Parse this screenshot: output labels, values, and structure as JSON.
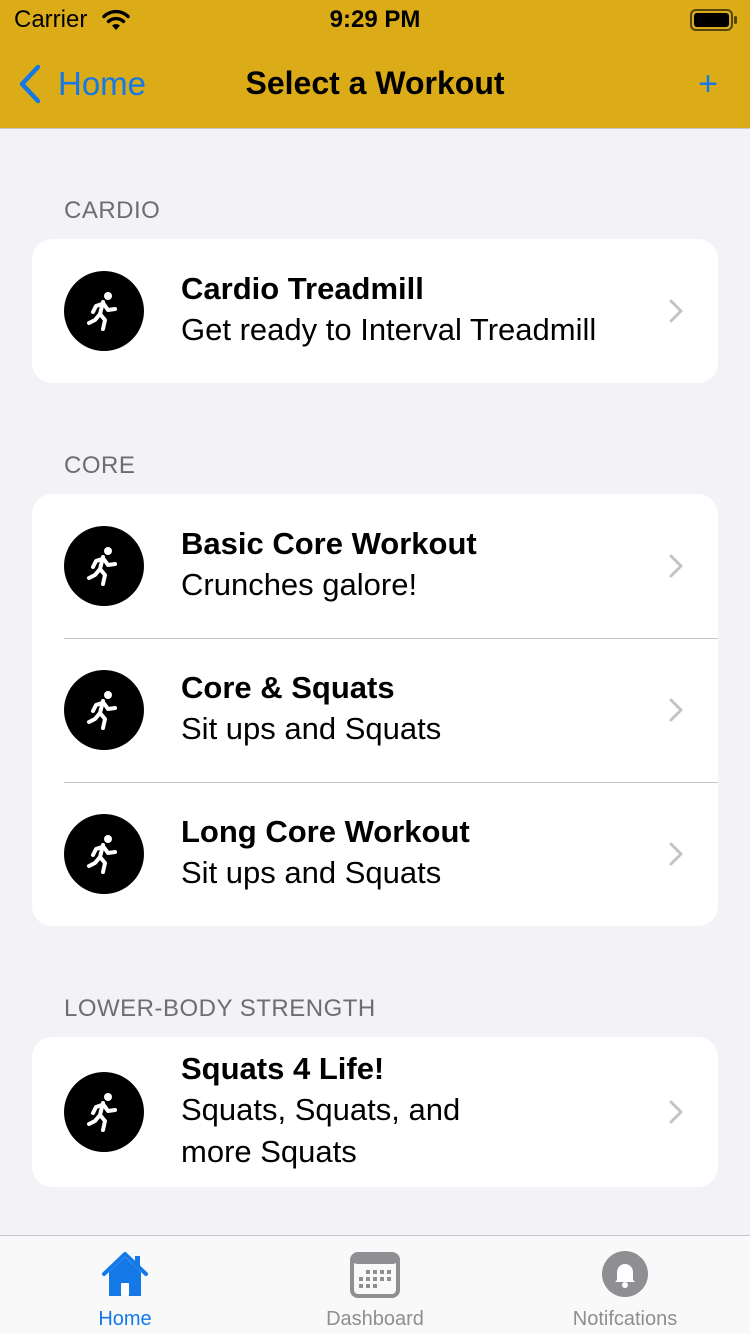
{
  "status_bar": {
    "carrier": "Carrier",
    "time": "9:29 PM",
    "wifi_icon": "wifi-icon",
    "battery_icon": "battery-full-icon"
  },
  "nav": {
    "back_label": "Home",
    "title": "Select a Workout",
    "add_label": "+",
    "accent_color": "#1479e6",
    "bar_color": "#dcac18"
  },
  "sections": [
    {
      "header": "CARDIO",
      "rows": [
        {
          "title": "Cardio Treadmill",
          "subtitle": "Get ready to Interval Treadmill",
          "icon": "running-person-icon"
        }
      ]
    },
    {
      "header": "CORE",
      "rows": [
        {
          "title": "Basic Core Workout",
          "subtitle": "Crunches galore!",
          "icon": "running-person-icon"
        },
        {
          "title": "Core & Squats",
          "subtitle": "Sit ups and Squats",
          "icon": "running-person-icon"
        },
        {
          "title": "Long Core Workout",
          "subtitle": "Sit ups and Squats",
          "icon": "running-person-icon"
        }
      ]
    },
    {
      "header": "LOWER-BODY STRENGTH",
      "rows": [
        {
          "title": "Squats 4 Life!",
          "subtitle_line1": "Squats, Squats, and",
          "subtitle_line2": "more Squats",
          "icon": "running-person-icon"
        }
      ]
    }
  ],
  "tabs": [
    {
      "label": "Home",
      "icon": "house-icon",
      "active": true
    },
    {
      "label": "Dashboard",
      "icon": "calendar-icon",
      "active": false
    },
    {
      "label": "Notifcations",
      "icon": "bell-icon",
      "active": false
    }
  ]
}
